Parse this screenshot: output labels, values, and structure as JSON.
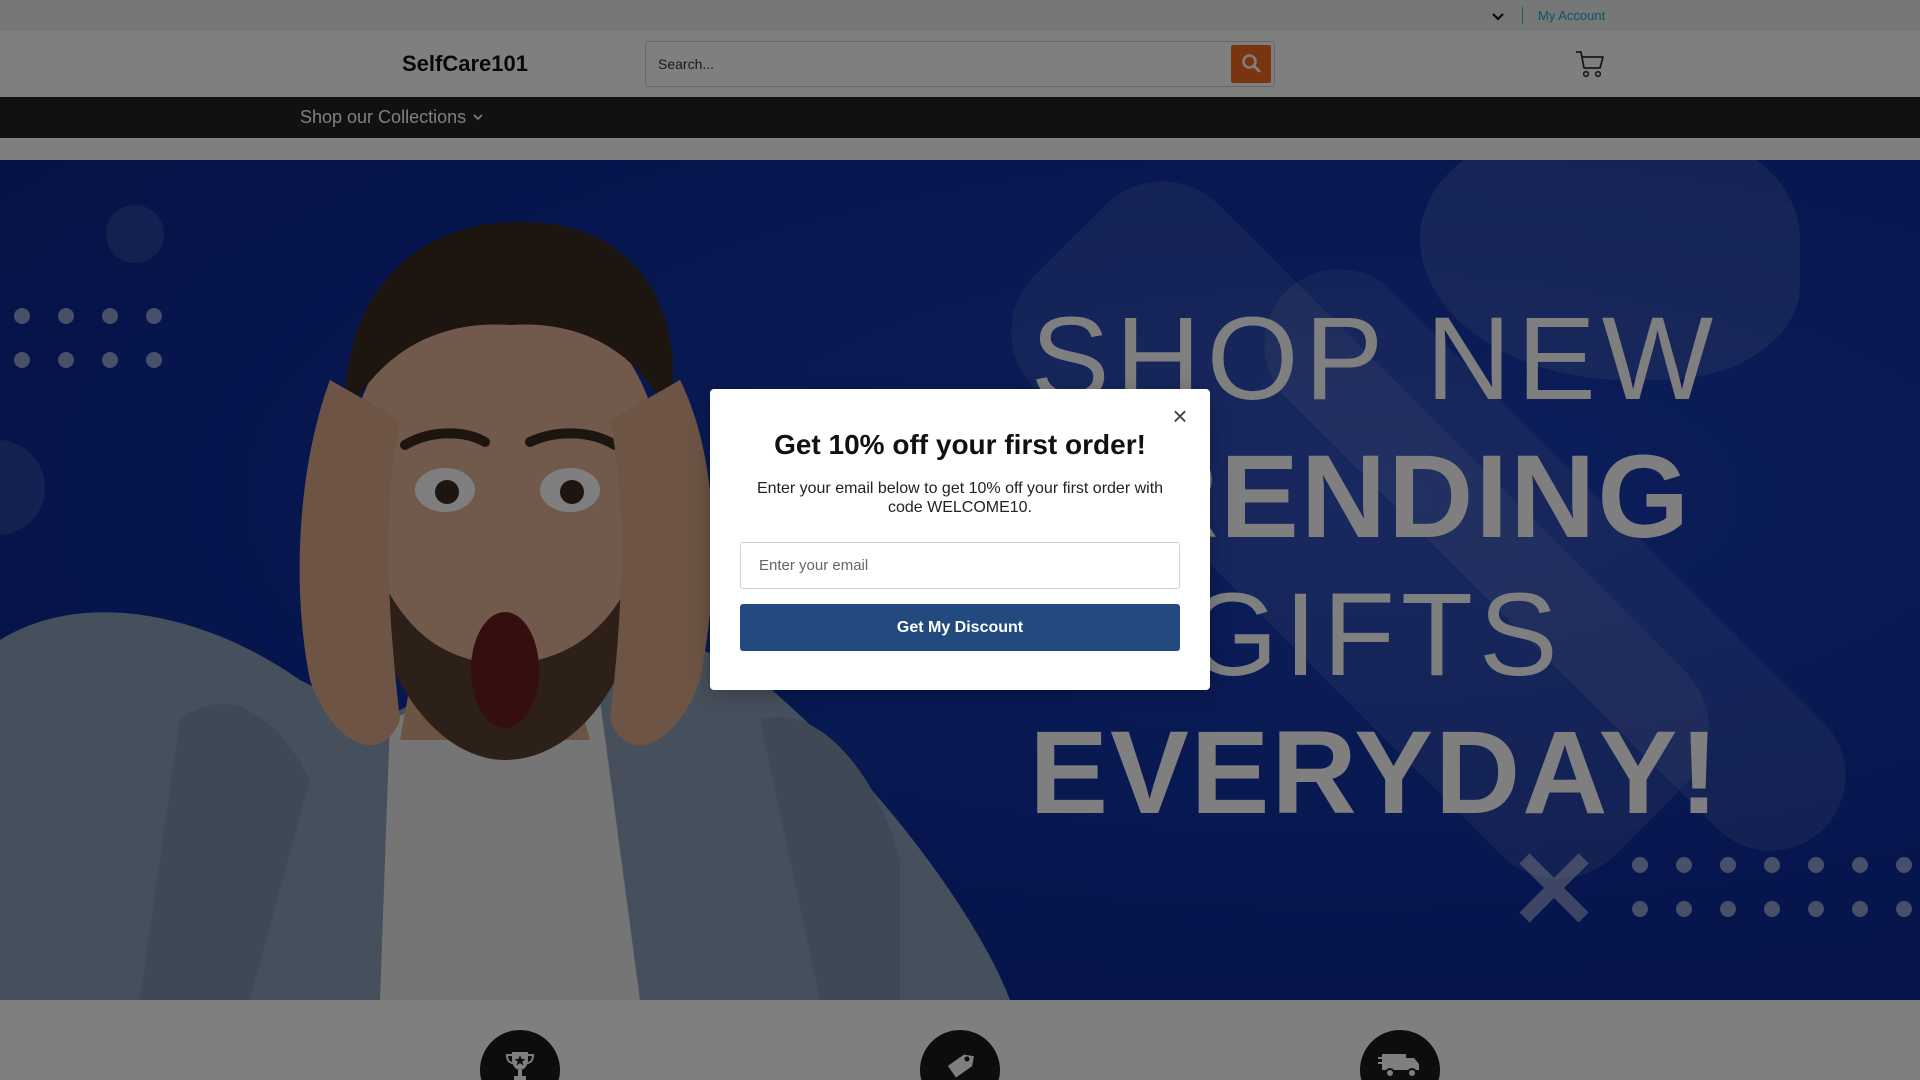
{
  "topbar": {
    "currency_icon": "chevron-down-icon",
    "account_label": "My Account"
  },
  "header": {
    "logo_text": "SelfCare101",
    "search_placeholder": "Search...",
    "search_icon": "search-icon",
    "cart_icon": "cart-icon"
  },
  "nav": {
    "collections_label": "Shop our Collections"
  },
  "hero": {
    "line1": "SHOP NEW",
    "line2": "TRENDING",
    "line3": "GIFTS",
    "line4": "EVERYDAY!"
  },
  "features": {
    "icons": [
      "trophy-icon",
      "tag-icon",
      "delivery-truck-icon"
    ]
  },
  "modal": {
    "close_label": "×",
    "title": "Get 10% off your first order!",
    "description": "Enter your email below to get 10% off your first order with code WELCOME10.",
    "email_placeholder": "Enter your email",
    "button_label": "Get My Discount"
  },
  "colors": {
    "accent_orange": "#f26b21",
    "cta_blue": "#234a7e",
    "hero_blue": "#0d2b9a",
    "link_cyan": "#1aa6d6",
    "nav_dark": "#232323"
  }
}
